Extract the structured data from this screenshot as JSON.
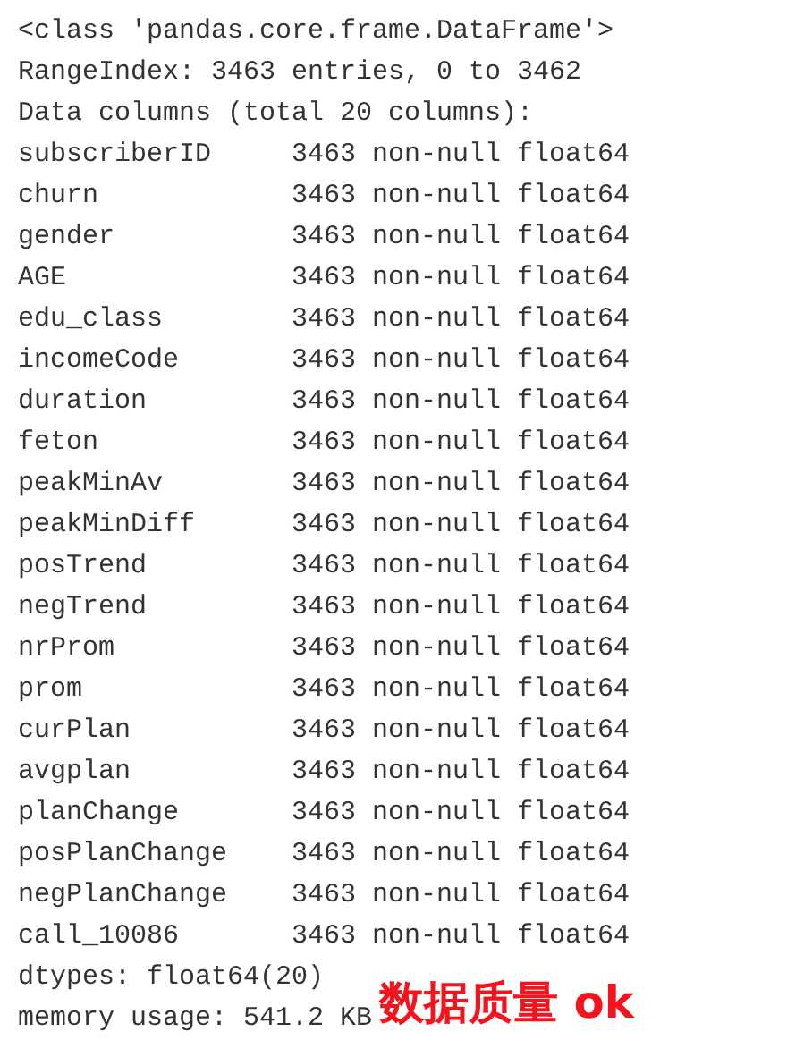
{
  "header_lines": [
    "<class 'pandas.core.frame.DataFrame'>",
    "RangeIndex: 3463 entries, 0 to 3462",
    "Data columns (total 20 columns):"
  ],
  "columns": [
    {
      "name": "subscriberID",
      "info": "3463 non-null float64"
    },
    {
      "name": "churn",
      "info": "3463 non-null float64"
    },
    {
      "name": "gender",
      "info": "3463 non-null float64"
    },
    {
      "name": "AGE",
      "info": "3463 non-null float64"
    },
    {
      "name": "edu_class",
      "info": "3463 non-null float64"
    },
    {
      "name": "incomeCode",
      "info": "3463 non-null float64"
    },
    {
      "name": "duration",
      "info": "3463 non-null float64"
    },
    {
      "name": "feton",
      "info": "3463 non-null float64"
    },
    {
      "name": "peakMinAv",
      "info": "3463 non-null float64"
    },
    {
      "name": "peakMinDiff",
      "info": "3463 non-null float64"
    },
    {
      "name": "posTrend",
      "info": "3463 non-null float64"
    },
    {
      "name": "negTrend",
      "info": "3463 non-null float64"
    },
    {
      "name": "nrProm",
      "info": "3463 non-null float64"
    },
    {
      "name": "prom",
      "info": "3463 non-null float64"
    },
    {
      "name": "curPlan",
      "info": "3463 non-null float64"
    },
    {
      "name": "avgplan",
      "info": "3463 non-null float64"
    },
    {
      "name": "planChange",
      "info": "3463 non-null float64"
    },
    {
      "name": "posPlanChange",
      "info": "3463 non-null float64"
    },
    {
      "name": "negPlanChange",
      "info": "3463 non-null float64"
    },
    {
      "name": "call_10086",
      "info": "3463 non-null float64"
    }
  ],
  "footer_lines": [
    "dtypes: float64(20)",
    "memory usage: 541.2 KB"
  ],
  "annotation": "数据质量 ok"
}
